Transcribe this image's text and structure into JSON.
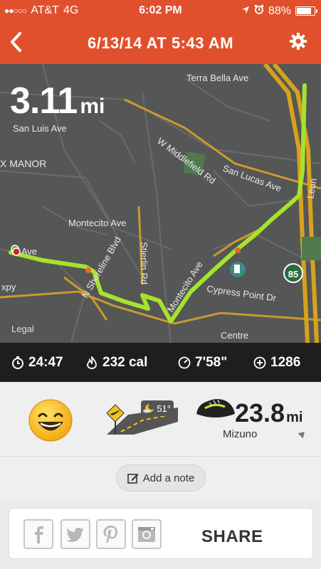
{
  "status": {
    "carrier": "AT&T",
    "network": "4G",
    "time": "6:02 PM",
    "battery_pct": "88%",
    "battery_fraction": 0.88,
    "icons": [
      "signal-dots-icon",
      "location-arrow-icon",
      "alarm-clock-icon",
      "battery-icon"
    ]
  },
  "nav": {
    "back_icon": "chevron-left-icon",
    "title": "6/13/14 AT 5:43 AM",
    "settings_icon": "gear-icon"
  },
  "map": {
    "distance_value": "3.11",
    "distance_unit": "mi",
    "legal": "Legal",
    "labels": [
      "Terra Bella Ave",
      "San Luis Ave",
      "X MANOR",
      "W Middlefield Rd",
      "San Lucas Ave",
      "Montecito Ave",
      "Stierlin Rd",
      "N Shoreline Blvd",
      "Montecito Ave",
      "Cypress Point Dr",
      "Centre",
      "Leon",
      "85",
      "xpy",
      "Ave"
    ]
  },
  "stats": {
    "duration": "24:47",
    "calories": "232 cal",
    "pace": "7'58\"",
    "fuel": "1286",
    "icons": [
      "stopwatch-icon",
      "flame-icon",
      "speedometer-icon",
      "nikefuel-icon"
    ]
  },
  "details": {
    "mood_icon": "smiley-face-icon",
    "terrain_icon": "road-terrain-icon",
    "weather_temp": "51°",
    "weather_icon": "moon-clouds-icon",
    "shoe_icon": "running-shoe-icon",
    "shoe_miles": "23.8",
    "shoe_unit": "mi",
    "shoe_name": "Mizuno",
    "add_note_label": "Add a note",
    "add_note_icon": "edit-note-icon"
  },
  "share": {
    "label": "SHARE",
    "icons": [
      "facebook-icon",
      "twitter-icon",
      "pinterest-icon",
      "instagram-icon"
    ]
  },
  "colors": {
    "brand": "#e0502c",
    "route": "#a6e22e",
    "map_bg": "#555656",
    "stats_bg": "#1e1e1e"
  }
}
